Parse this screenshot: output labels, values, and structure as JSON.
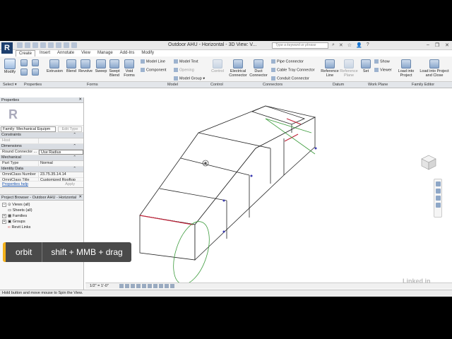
{
  "titlebar": {
    "logo": "R",
    "title": "Outdoor AHU - Horizontal - 3D View: V...",
    "search_placeholder": "Type a keyword or phrase"
  },
  "tabs": [
    "Create",
    "Insert",
    "Annotate",
    "View",
    "Manage",
    "Add-Ins",
    "Modify"
  ],
  "ribbon": {
    "modify": "Modify",
    "select": "Select ▾",
    "properties": "Properties",
    "forms": [
      "Extrusion",
      "Blend",
      "Revolve",
      "Sweep",
      "Swept Blend",
      "Void Forms"
    ],
    "forms_label": "Forms",
    "model": [
      "Model Line",
      "Model Text",
      "Component",
      "Opening",
      "Model Group ▾"
    ],
    "model_label": "Model",
    "control": "Control",
    "control_label": "Control",
    "connectors": [
      "Electrical Connector",
      "Duct Connector",
      "Pipe Connector",
      "Cable Tray Connector",
      "Conduit Connector"
    ],
    "connectors_label": "Connectors",
    "datum": [
      "Reference Line",
      "Reference Plane"
    ],
    "datum_label": "Datum",
    "workplane": [
      "Set",
      "Show",
      "Viewer"
    ],
    "workplane_label": "Work Plane",
    "family_editor": [
      "Load into Project",
      "Load into Project and Close"
    ],
    "family_editor_label": "Family Editor"
  },
  "properties": {
    "header": "Properties",
    "family": "Family: Mechanical Equipm",
    "edit_type": "Edit Type",
    "sections": [
      {
        "name": "Constraints",
        "rows": [
          {
            "k": "Host",
            "v": "",
            "dim": true
          }
        ]
      },
      {
        "name": "Dimensions",
        "rows": [
          {
            "k": "Round Connector ...",
            "v": "Use Radius"
          }
        ]
      },
      {
        "name": "Mechanical",
        "rows": [
          {
            "k": "Part Type",
            "v": "Normal"
          }
        ]
      },
      {
        "name": "Identity Data",
        "rows": [
          {
            "k": "OmniClass Number",
            "v": "23.75.35.14.14"
          },
          {
            "k": "OmniClass Title",
            "v": "Customized Rooftop"
          }
        ]
      }
    ],
    "help": "Properties help",
    "apply": "Apply"
  },
  "project_browser": {
    "header": "Project Browser - Outdoor AHU - Horizontal",
    "items": [
      {
        "label": "Views (all)",
        "toggle": "−"
      },
      {
        "label": "Sheets (all)",
        "toggle": ""
      },
      {
        "label": "Families",
        "toggle": "+"
      },
      {
        "label": "Groups",
        "toggle": "+"
      },
      {
        "label": "Revit Links",
        "toggle": ""
      }
    ]
  },
  "view_control": {
    "scale": "1/2\" = 1'-0\""
  },
  "status": "Hold button and move mouse to Spin the View.",
  "tooltip": {
    "action": "orbit",
    "shortcut": "shift + MMB + drag"
  },
  "watermark": "Linked in",
  "colors": {
    "accent": "#f4b21c",
    "ribbon_bg": "#f4f4f4",
    "tip_bg": "#4a4a4a"
  }
}
